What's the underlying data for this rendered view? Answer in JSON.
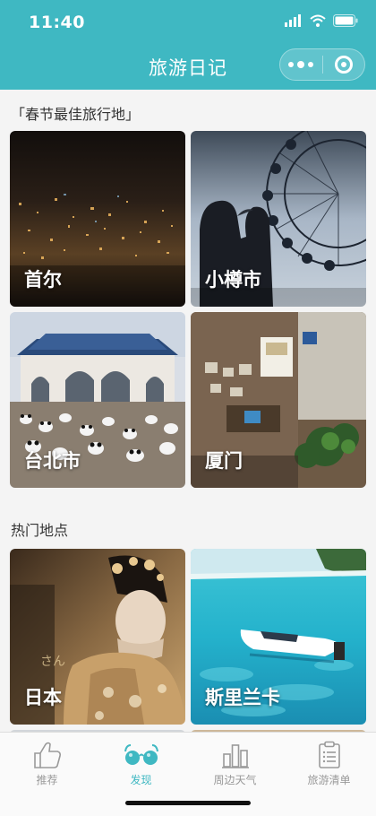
{
  "status_bar": {
    "time": "11:40"
  },
  "nav": {
    "title": "旅游日记"
  },
  "sections": {
    "spring": {
      "title": "「春节最佳旅行地」",
      "cards": [
        {
          "label": "首尔"
        },
        {
          "label": "小樽市"
        },
        {
          "label": "台北市"
        },
        {
          "label": "厦门"
        }
      ]
    },
    "hot": {
      "title": "热门地点",
      "cards": [
        {
          "label": "日本"
        },
        {
          "label": "斯里兰卡"
        }
      ]
    }
  },
  "tabbar": {
    "tabs": [
      {
        "label": "推荐",
        "icon": "thumbs-up-icon"
      },
      {
        "label": "发现",
        "icon": "glasses-icon"
      },
      {
        "label": "周边天气",
        "icon": "bar-chart-icon"
      },
      {
        "label": "旅游清单",
        "icon": "clipboard-list-icon"
      }
    ],
    "active": "发现"
  },
  "colors": {
    "accent": "#3fb8c2",
    "inactive": "#999999"
  }
}
